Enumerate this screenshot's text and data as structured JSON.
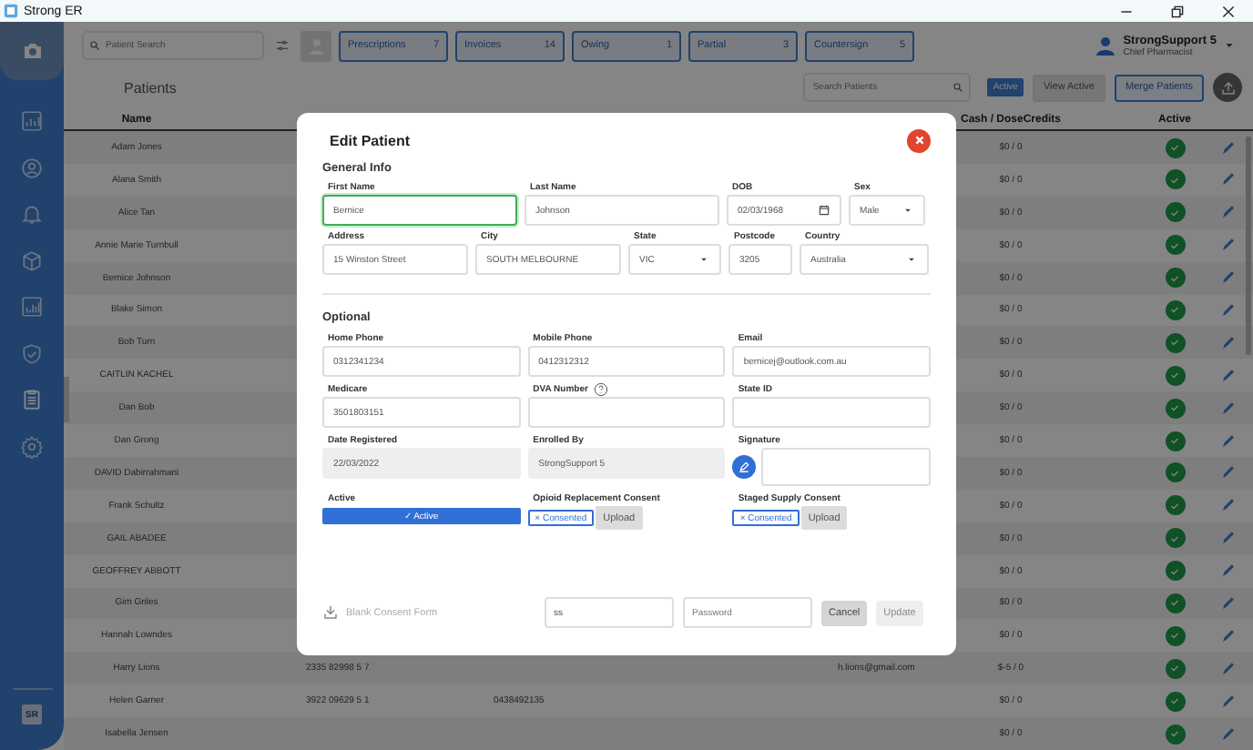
{
  "window": {
    "title": "Strong ER"
  },
  "sidebar": {
    "items": [
      {
        "selected": false
      },
      {
        "selected": false
      },
      {
        "selected": false
      },
      {
        "selected": false
      },
      {
        "selected": false
      },
      {
        "selected": false
      },
      {
        "selected": true
      },
      {
        "selected": false
      }
    ],
    "user_badge": "SR"
  },
  "topbar": {
    "search": {
      "placeholder": "Patient Search"
    },
    "chips": [
      {
        "label": "Prescriptions",
        "count": "7"
      },
      {
        "label": "Invoices",
        "count": "14"
      },
      {
        "label": "Owing",
        "count": "1"
      },
      {
        "label": "Partial",
        "count": "3"
      },
      {
        "label": "Countersign",
        "count": "5"
      }
    ],
    "user": {
      "name": "StrongSupport 5",
      "role": "Chief Pharmacist"
    }
  },
  "patients": {
    "title": "Patients",
    "search": {
      "placeholder": "Search Patients"
    },
    "filter_badge": "Active",
    "buttons": [
      {
        "label": "View Active",
        "kind": "plain"
      },
      {
        "label": "Merge Patients",
        "kind": "outline"
      }
    ]
  },
  "table": {
    "columns": [
      "Name",
      "Cash / DoseCredits",
      "Active"
    ],
    "rows": [
      {
        "name": "Adam Jones",
        "cash": "$0 / 0",
        "active": true
      },
      {
        "name": "Alana Smith",
        "cash": "$0 / 0",
        "active": true
      },
      {
        "name": "Alice Tan",
        "cash": "$0 / 0",
        "active": true
      },
      {
        "name": "Annie Marie Turnbull",
        "cash": "$0 / 0",
        "active": true
      },
      {
        "name": "Bernice Johnson",
        "cash": "$0 / 0",
        "active": true
      },
      {
        "name": "Blake Simon",
        "cash": "$0 / 0",
        "active": true
      },
      {
        "name": "Bob Turn",
        "cash": "$0 / 0",
        "active": true
      },
      {
        "name": "CAITLIN KACHEL",
        "cash": "$0 / 0",
        "active": true
      },
      {
        "name": "Dan Bob",
        "cash": "$0 / 0",
        "active": true
      },
      {
        "name": "Dan Grong",
        "cash": "$0 / 0",
        "active": true
      },
      {
        "name": "DAVID Dabirrahmani",
        "cash": "$0 / 0",
        "active": true
      },
      {
        "name": "Frank Schultz",
        "cash": "$0 / 0",
        "active": true
      },
      {
        "name": "GAIL ABADEE",
        "cash": "$0 / 0",
        "active": true
      },
      {
        "name": "GEOFFREY ABBOTT",
        "cash": "$0 / 0",
        "active": true
      },
      {
        "name": "Gim Griles",
        "cash": "$0 / 0",
        "active": true
      },
      {
        "name": "Hannah Lowndes",
        "cash": "$0 / 0",
        "active": true
      },
      {
        "name": "Harry Lions",
        "medicare": "2335 82998 5 7",
        "email": "h.lions@gmail.com",
        "cash": "$-5 / 0",
        "active": true
      },
      {
        "name": "Helen Garner",
        "medicare": "3922 09629 5 1",
        "mobile": "0438492135",
        "cash": "$0 / 0",
        "active": true
      },
      {
        "name": "Isabella Jensen",
        "cash": "$0 / 0",
        "active": true
      }
    ]
  },
  "dialog": {
    "title": "Edit Patient",
    "sections": [
      {
        "title": "General Info",
        "rows": [
          {
            "fields": [
              {
                "label": "First Name",
                "value": "Bernice",
                "kind": "text",
                "focused": true
              },
              {
                "label": "Last Name",
                "value": "Johnson",
                "kind": "text",
                "focused": false
              },
              {
                "label": "DOB",
                "value": "02/03/1968",
                "kind": "date",
                "focused": false
              },
              {
                "label": "Sex",
                "value": "Male",
                "kind": "select",
                "focused": false
              }
            ]
          },
          {
            "fields": [
              {
                "label": "Address",
                "value": "15 Winston Street",
                "kind": "text",
                "focused": false
              },
              {
                "label": "City",
                "value": "SOUTH MELBOURNE",
                "kind": "text",
                "focused": false
              },
              {
                "label": "State",
                "value": "VIC",
                "kind": "select",
                "focused": false
              },
              {
                "label": "Postcode",
                "value": "3205",
                "kind": "text",
                "focused": false
              },
              {
                "label": "Country",
                "value": "Australia",
                "kind": "select",
                "focused": false
              }
            ]
          }
        ]
      },
      {
        "title": "Optional",
        "rows": [
          {
            "fields": [
              {
                "label": "Home Phone",
                "value": "0312341234",
                "kind": "text",
                "focused": false
              },
              {
                "label": "Mobile Phone",
                "value": "0412312312",
                "kind": "text",
                "focused": false
              },
              {
                "label": "Email",
                "value": "bernicej@outlook.com.au",
                "kind": "text",
                "focused": false
              }
            ]
          },
          {
            "fields": [
              {
                "label": "Medicare",
                "value": "3501803151",
                "kind": "text",
                "focused": false
              },
              {
                "label": "DVA Number",
                "kind": "help",
                "focused": false
              },
              {
                "label": "State ID",
                "kind": "text",
                "focused": false
              }
            ]
          },
          {
            "fields": [
              {
                "label": "Date Registered",
                "value": "22/03/2022",
                "kind": "readonly"
              },
              {
                "label": "Enrolled By",
                "value": "StrongSupport 5",
                "kind": "readonly"
              },
              {
                "label": "Signature",
                "kind": "signature"
              }
            ]
          },
          {
            "fields": [
              {
                "label": "Active",
                "kind": "toggle",
                "text": "✓ Active",
                "on": true
              },
              {
                "label": "Opioid Replacement Consent",
                "kind": "consent",
                "chip": "× Consented",
                "consented": true,
                "button": "Upload"
              },
              {
                "label": "Staged Supply Consent",
                "kind": "consent",
                "chip": "× Consented",
                "consented": true,
                "button": "Upload"
              }
            ]
          }
        ]
      }
    ],
    "footer": {
      "link": "Blank Consent Form",
      "username": "ss",
      "password_placeholder": "Password",
      "cancel": "Cancel",
      "update": {
        "label": "Update",
        "disabled": true
      }
    }
  }
}
